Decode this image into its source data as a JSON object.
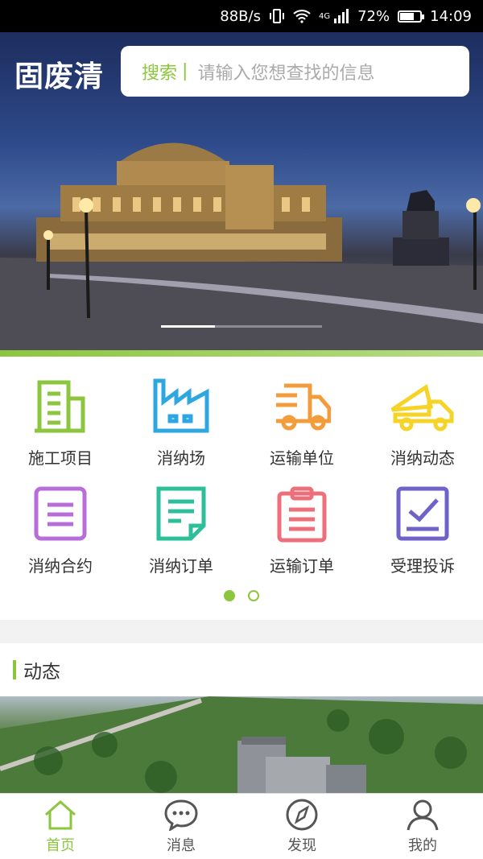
{
  "status_bar": {
    "speed": "88B/s",
    "network": "4G",
    "battery": "72%",
    "battery_level": 0.72,
    "time": "14:09"
  },
  "header": {
    "logo": "固废清",
    "search_label": "搜索",
    "search_placeholder": "请输入您想查找的信息"
  },
  "banner": {
    "slide_count": 3,
    "active_slide": 1
  },
  "menu": {
    "items": [
      {
        "label": "施工项目",
        "icon": "building-icon",
        "color": "#8cc63f"
      },
      {
        "label": "消纳场",
        "icon": "factory-icon",
        "color": "#2ea7e0"
      },
      {
        "label": "运输单位",
        "icon": "truck-icon",
        "color": "#f39c3c"
      },
      {
        "label": "消纳动态",
        "icon": "dump-truck-icon",
        "color": "#f5d327"
      },
      {
        "label": "消纳合约",
        "icon": "contract-icon",
        "color": "#b86ed9"
      },
      {
        "label": "消纳订单",
        "icon": "order-doc-icon",
        "color": "#2dbf9a"
      },
      {
        "label": "运输订单",
        "icon": "clipboard-icon",
        "color": "#ec6f7a"
      },
      {
        "label": "受理投诉",
        "icon": "complaint-check-icon",
        "color": "#6f62c9"
      }
    ],
    "page_count": 2,
    "active_page": 1
  },
  "dynamic": {
    "title": "动态"
  },
  "bottom_nav": {
    "items": [
      {
        "label": "首页",
        "icon": "home-icon"
      },
      {
        "label": "消息",
        "icon": "chat-icon"
      },
      {
        "label": "发现",
        "icon": "compass-icon"
      },
      {
        "label": "我的",
        "icon": "user-icon"
      }
    ],
    "active": 0,
    "active_color": "#8cc63f"
  }
}
